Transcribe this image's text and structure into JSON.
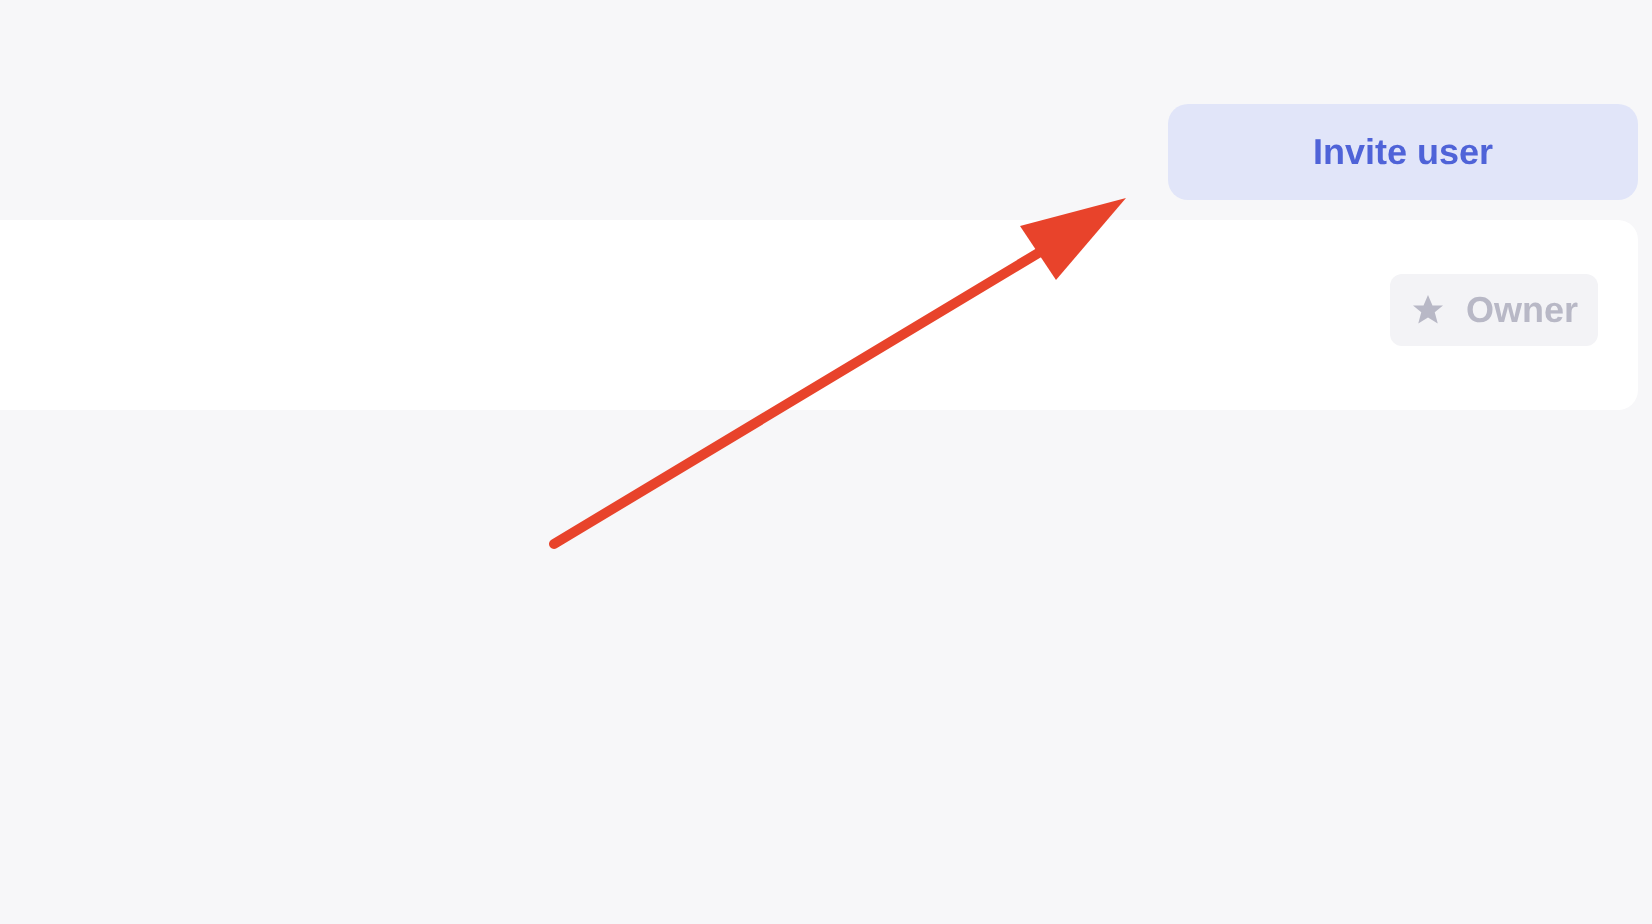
{
  "invite_button": {
    "label": "Invite user"
  },
  "member": {
    "role_badge": "Owner"
  },
  "annotation": {
    "kind": "arrow"
  }
}
